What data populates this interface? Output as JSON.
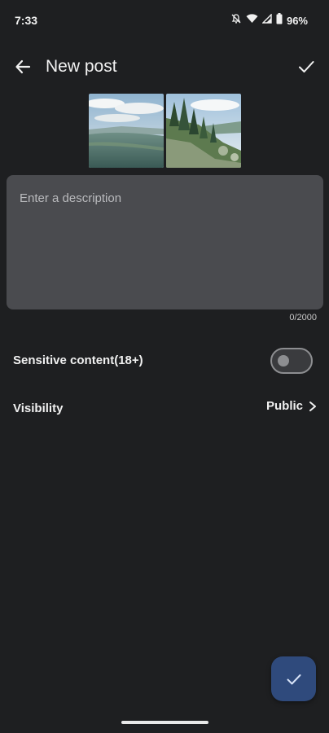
{
  "status_bar": {
    "time": "7:33",
    "battery_percent": "96%",
    "icons": [
      "mute-icon",
      "wifi-icon",
      "signal-icon",
      "battery-icon"
    ]
  },
  "app_bar": {
    "title": "New post",
    "back_icon": "arrow-left-icon",
    "confirm_icon": "check-icon"
  },
  "attachments": [
    {
      "name": "landscape-valley-photo"
    },
    {
      "name": "forest-hillside-photo"
    }
  ],
  "description": {
    "placeholder": "Enter a description",
    "value": "",
    "counter": "0/2000"
  },
  "settings": {
    "sensitive_label": "Sensitive content(18+)",
    "sensitive_enabled": false,
    "visibility_label": "Visibility",
    "visibility_value": "Public"
  },
  "fab": {
    "icon": "check-icon"
  },
  "colors": {
    "background": "#1e1f21",
    "input_background": "#4a4b4f",
    "fab_background": "#2f4a7c",
    "text": "#f0f0f0"
  }
}
